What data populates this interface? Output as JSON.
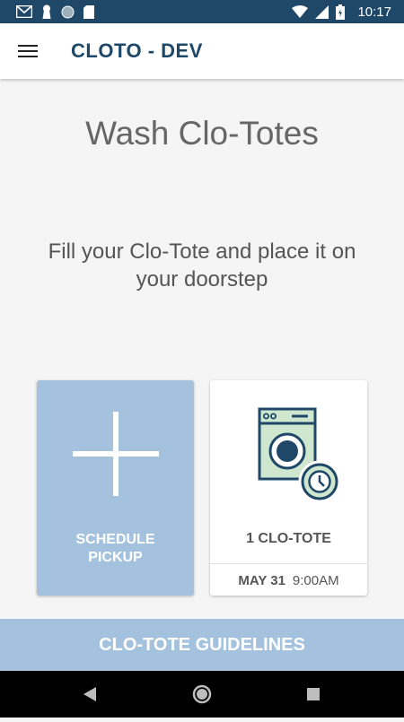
{
  "status_bar": {
    "time": "10:17",
    "icons": [
      "gmail-icon",
      "keyhole-icon",
      "circle-icon",
      "sd-card-icon",
      "wifi-icon",
      "signal-icon",
      "battery-icon"
    ]
  },
  "app_bar": {
    "title": "CLOTO - DEV"
  },
  "main": {
    "title": "Wash Clo-Totes",
    "subtitle": "Fill your Clo-Tote and place it on your doorstep"
  },
  "cards": {
    "schedule": {
      "label_line1": "SCHEDULE",
      "label_line2": "PICKUP"
    },
    "tote": {
      "count_label": "1 CLO-TOTE",
      "date": "MAY 31",
      "time": "9:00AM"
    }
  },
  "footer": {
    "guidelines_label": "CLO-TOTE GUIDELINES"
  },
  "colors": {
    "status_bar": "#1f4868",
    "brand_blue": "#1f4868",
    "card_blue": "#a4c2de",
    "washer_green": "#cfe7cf"
  }
}
